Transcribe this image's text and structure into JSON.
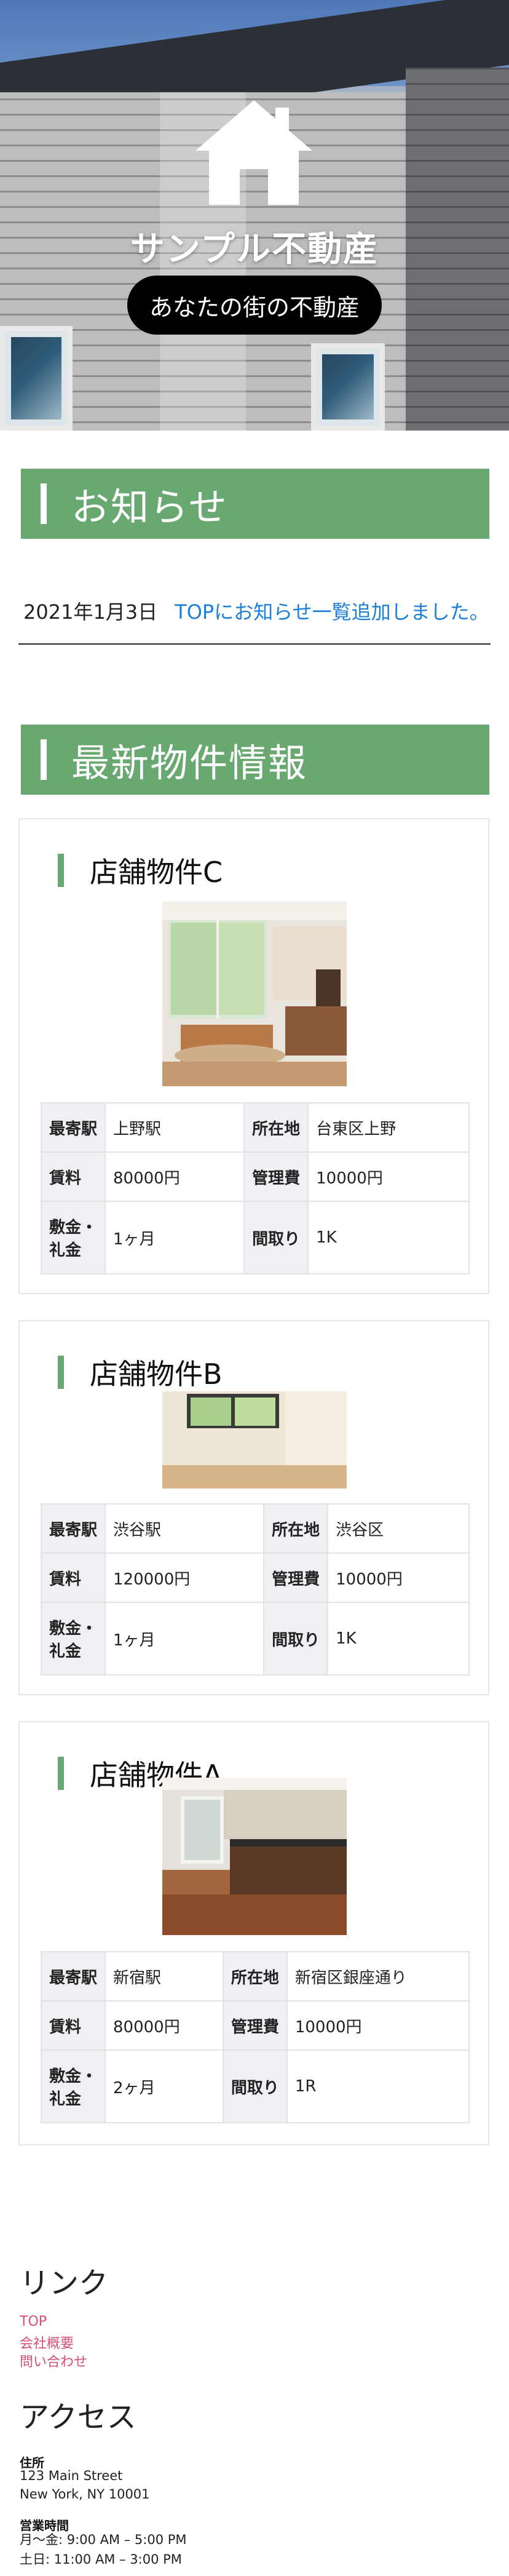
{
  "hero": {
    "title": "サンプル不動産",
    "tagline": "あなたの街の不動産"
  },
  "news": {
    "heading": "お知らせ",
    "items": [
      {
        "date": "2021年1月3日",
        "text": "TOPにお知らせ一覧追加しました。"
      }
    ]
  },
  "listings": {
    "heading": "最新物件情報",
    "labels": {
      "station": "最寄駅",
      "location": "所在地",
      "rent": "賃料",
      "fee": "管理費",
      "deposit": "敷金・礼金",
      "layout": "間取り"
    },
    "items": [
      {
        "name": "店舗物件C",
        "station": "上野駅",
        "location": "台東区上野",
        "rent": "80000円",
        "fee": "10000円",
        "deposit": "1ヶ月",
        "layout": "1K"
      },
      {
        "name": "店舗物件B",
        "station": "渋谷駅",
        "location": "渋谷区",
        "rent": "120000円",
        "fee": "10000円",
        "deposit": "1ヶ月",
        "layout": "1K"
      },
      {
        "name": "店舗物件A",
        "station": "新宿駅",
        "location": "新宿区銀座通り",
        "rent": "80000円",
        "fee": "10000円",
        "deposit": "2ヶ月",
        "layout": "1R"
      }
    ]
  },
  "footer": {
    "links_heading": "リンク",
    "links": [
      "TOP",
      "会社概要",
      "問い合わせ"
    ],
    "access_heading": "アクセス",
    "address_label": "住所",
    "address_line1": "123 Main Street",
    "address_line2": "New York, NY 10001",
    "hours_label": "営業時間",
    "hours_weekday": "月〜金: 9:00 AM – 5:00 PM",
    "hours_weekend": "土日: 11:00 AM – 3:00 PM"
  },
  "colors": {
    "accent_green": "#6aa872",
    "link_blue": "#1e7fd8",
    "footer_link_pink": "#d84f72"
  }
}
